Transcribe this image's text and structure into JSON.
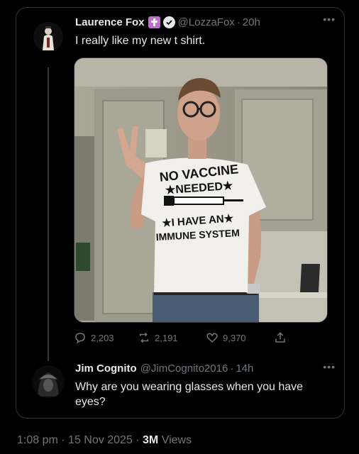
{
  "tweet": {
    "author_name": "Laurence Fox",
    "handle": "@LozzaFox",
    "separator": "·",
    "time": "20h",
    "text": "I really like my new t shirt.",
    "shirt_text": {
      "line1": "NO VACCINE",
      "line2": "★NEEDED★",
      "line3": "★I HAVE AN★",
      "line4": "IMMUNE SYSTEM"
    },
    "stats": {
      "replies": "2,203",
      "reposts": "2,191",
      "likes": "9,370"
    }
  },
  "reply": {
    "author_name": "Jim Cognito",
    "handle": "@JimCognito2016",
    "separator": "·",
    "time": "14h",
    "text": "Why are you wearing glasses when you have eyes?"
  },
  "footer": {
    "time": "1:08 pm",
    "date": "15 Nov 2025",
    "separator": "·",
    "views_count": "3M",
    "views_label": "Views"
  },
  "icons": {
    "verified": "verified-check-icon",
    "badge": "cross-badge-icon",
    "reply": "reply-bubble-icon",
    "repost": "repost-icon",
    "like": "heart-icon",
    "share": "share-icon",
    "more": "more-dots-icon"
  },
  "colors": {
    "background": "#000000",
    "text": "#e7e9ea",
    "muted": "#71767b",
    "border": "#2f3336",
    "badge": "#c56bd6"
  }
}
